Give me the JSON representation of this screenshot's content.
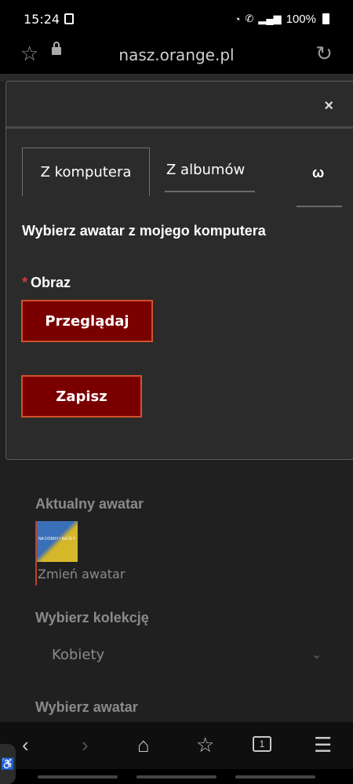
{
  "status_bar": {
    "time": "15:24",
    "battery": "100%"
  },
  "browser": {
    "url": "nasz.orange.pl"
  },
  "modal": {
    "tabs": [
      {
        "label": "Z komputera"
      },
      {
        "label": "Z albumów"
      }
    ],
    "more_tabs_glyph": "ω",
    "title": "Wybierz awatar z mojego komputera",
    "field_label": "Obraz",
    "required_mark": "*",
    "browse_label": "Przeglądaj",
    "save_label": "Zapisz",
    "close_glyph": "×"
  },
  "page": {
    "current_avatar_label": "Aktualny awatar",
    "avatar_image_text": "NA DOBRY I NA ZŁY",
    "change_avatar_label": "Zmień awatar",
    "collection_label": "Wybierz kolekcję",
    "collection_value": "Kobiety",
    "choose_avatar_label": "Wybierz awatar"
  },
  "bottom_nav": {
    "tabs_count": "1"
  },
  "colors": {
    "button_bg": "#7a0000",
    "button_border": "#d4502a",
    "required_star": "#d43a3a"
  }
}
